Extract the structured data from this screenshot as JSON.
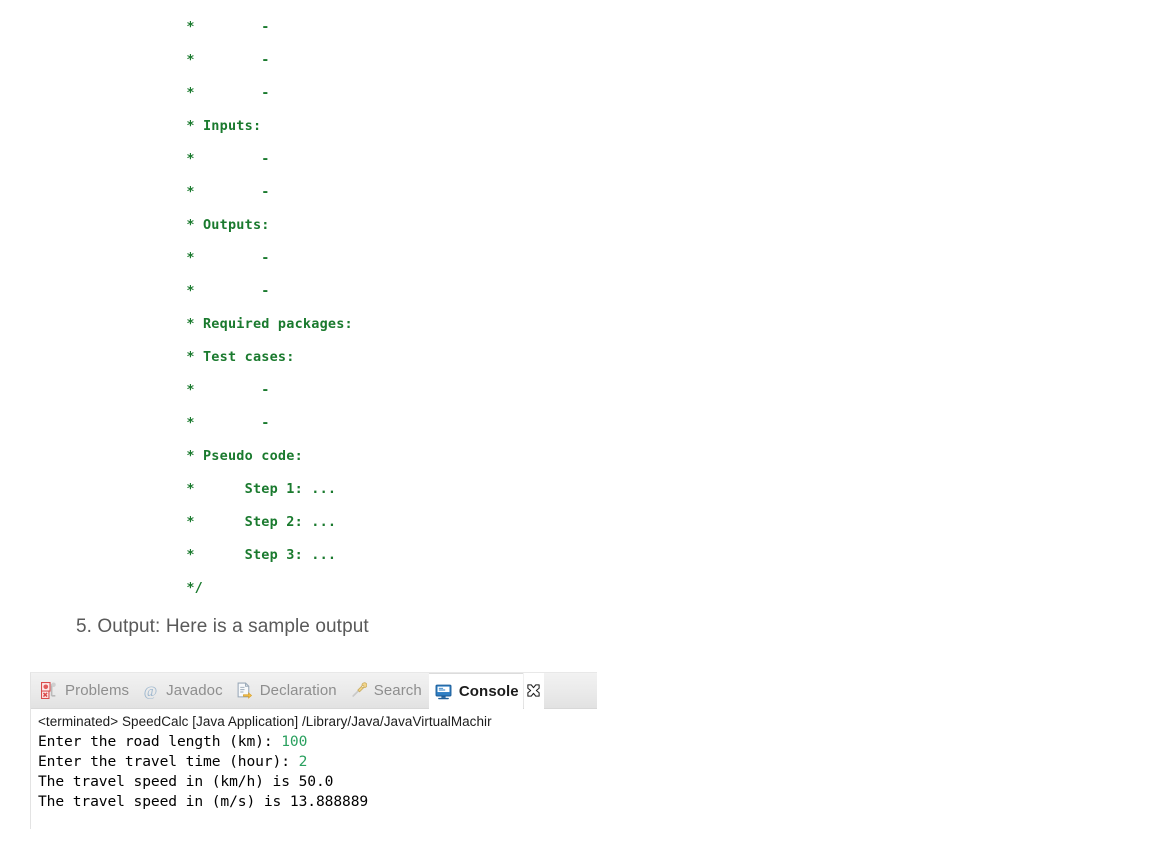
{
  "comment_block": {
    "color": "#1a7a2e",
    "lines": [
      " *        -",
      " *        -",
      " *        -",
      " * Inputs:",
      " *        -",
      " *        -",
      " * Outputs:",
      " *        -",
      " *        -",
      " * Required packages:",
      " * Test cases:",
      " *        -",
      " *        -",
      " * Pseudo code:",
      " *      Step 1: ...",
      " *      Step 2: ...",
      " *      Step 3: ...",
      " */"
    ]
  },
  "output_heading": "5. Output: Here is a sample output",
  "console_panel": {
    "tabs": [
      {
        "label": "Problems",
        "icon": "problems-marker-icon",
        "active": false
      },
      {
        "label": "Javadoc",
        "icon": "at-sign-icon",
        "active": false
      },
      {
        "label": "Declaration",
        "icon": "declaration-document-icon",
        "active": false
      },
      {
        "label": "Search",
        "icon": "search-pin-icon",
        "active": false
      },
      {
        "label": "Console",
        "icon": "console-monitor-icon",
        "active": true
      }
    ],
    "maximize_glyph": "maximize-restore-icon",
    "launch_line": "<terminated> SpeedCalc [Java Application] /Library/Java/JavaVirtualMachir",
    "output_lines": [
      {
        "prompt": "Enter the road length (km): ",
        "echo": "100"
      },
      {
        "prompt": "Enter the travel time (hour): ",
        "echo": "2"
      },
      {
        "prompt": "The travel speed in (km/h) is 50.0",
        "echo": ""
      },
      {
        "prompt": "The travel speed in (m/s) is 13.888889",
        "echo": ""
      }
    ],
    "echo_color": "#2aa05f"
  }
}
